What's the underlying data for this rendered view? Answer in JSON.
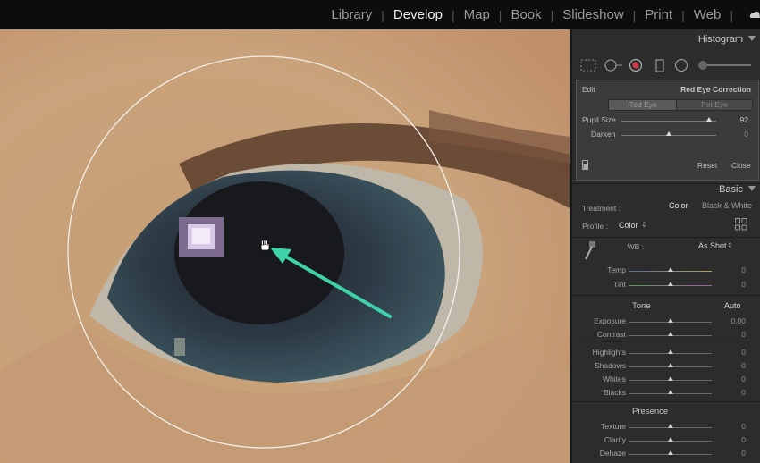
{
  "modules": {
    "items": [
      "Library",
      "Develop",
      "Map",
      "Book",
      "Slideshow",
      "Print",
      "Web"
    ],
    "active": "Develop"
  },
  "panel": {
    "histogram_title": "Histogram",
    "basic_title": "Basic",
    "tools": [
      "crop-overlay-icon",
      "spot-removal-icon",
      "red-eye-icon",
      "graduated-filter-icon",
      "radial-filter-icon",
      "adjustment-brush-icon"
    ],
    "red_eye": {
      "edit_label": "Edit",
      "title": "Red Eye Correction",
      "mode_red": "Red Eye",
      "mode_pet": "Pet Eye",
      "pupil_label": "Pupil Size",
      "pupil_value": "92",
      "pupil_level": 0.92,
      "darken_label": "Darken",
      "darken_value": "0",
      "darken_level": 0.5,
      "reset_label": "Reset",
      "close_label": "Close"
    },
    "basic": {
      "treatment_label": "Treatment :",
      "treatment_color": "Color",
      "treatment_bw": "Black & White",
      "profile_label": "Profile :",
      "profile_value": "Color",
      "wb_label": "WB :",
      "wb_value": "As Shot",
      "temp_label": "Temp",
      "temp_value": "0",
      "tint_label": "Tint",
      "tint_value": "0",
      "tone_label": "Tone",
      "auto_label": "Auto",
      "exposure_label": "Exposure",
      "exposure_value": "0.00",
      "contrast_label": "Contrast",
      "contrast_value": "0",
      "highlights_label": "Highlights",
      "highlights_value": "0",
      "shadows_label": "Shadows",
      "shadows_value": "0",
      "whites_label": "Whites",
      "whites_value": "0",
      "blacks_label": "Blacks",
      "blacks_value": "0",
      "presence_label": "Presence",
      "texture_label": "Texture",
      "texture_value": "0",
      "clarity_label": "Clarity",
      "clarity_value": "0",
      "dehaze_label": "Dehaze",
      "dehaze_value": "0"
    }
  },
  "colors": {
    "arrow": "#3fd3aa",
    "circle": "#ffffff",
    "panel_bg": "#2c2c2c"
  }
}
